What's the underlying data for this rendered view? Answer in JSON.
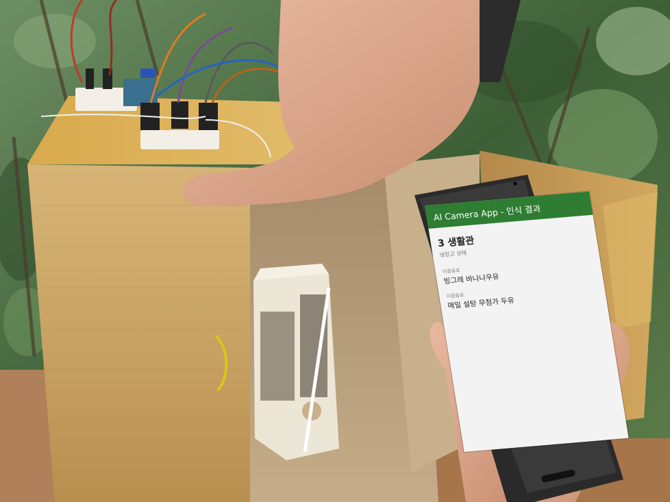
{
  "app": {
    "title": "AI Camera App - 인식 결과",
    "room": "3 생활관",
    "status": "냉장고 상태",
    "items": [
      {
        "caption": "이름음료",
        "name": "빙그레 바나나우유"
      },
      {
        "caption": "이름음료",
        "name": "매일 설탕 무첨가 두유"
      }
    ]
  },
  "colors": {
    "app_bar": "#2e7d32",
    "screen_bg": "#f3f3f3",
    "box": "#c9a66a",
    "foliage": "#3f6b3a"
  }
}
